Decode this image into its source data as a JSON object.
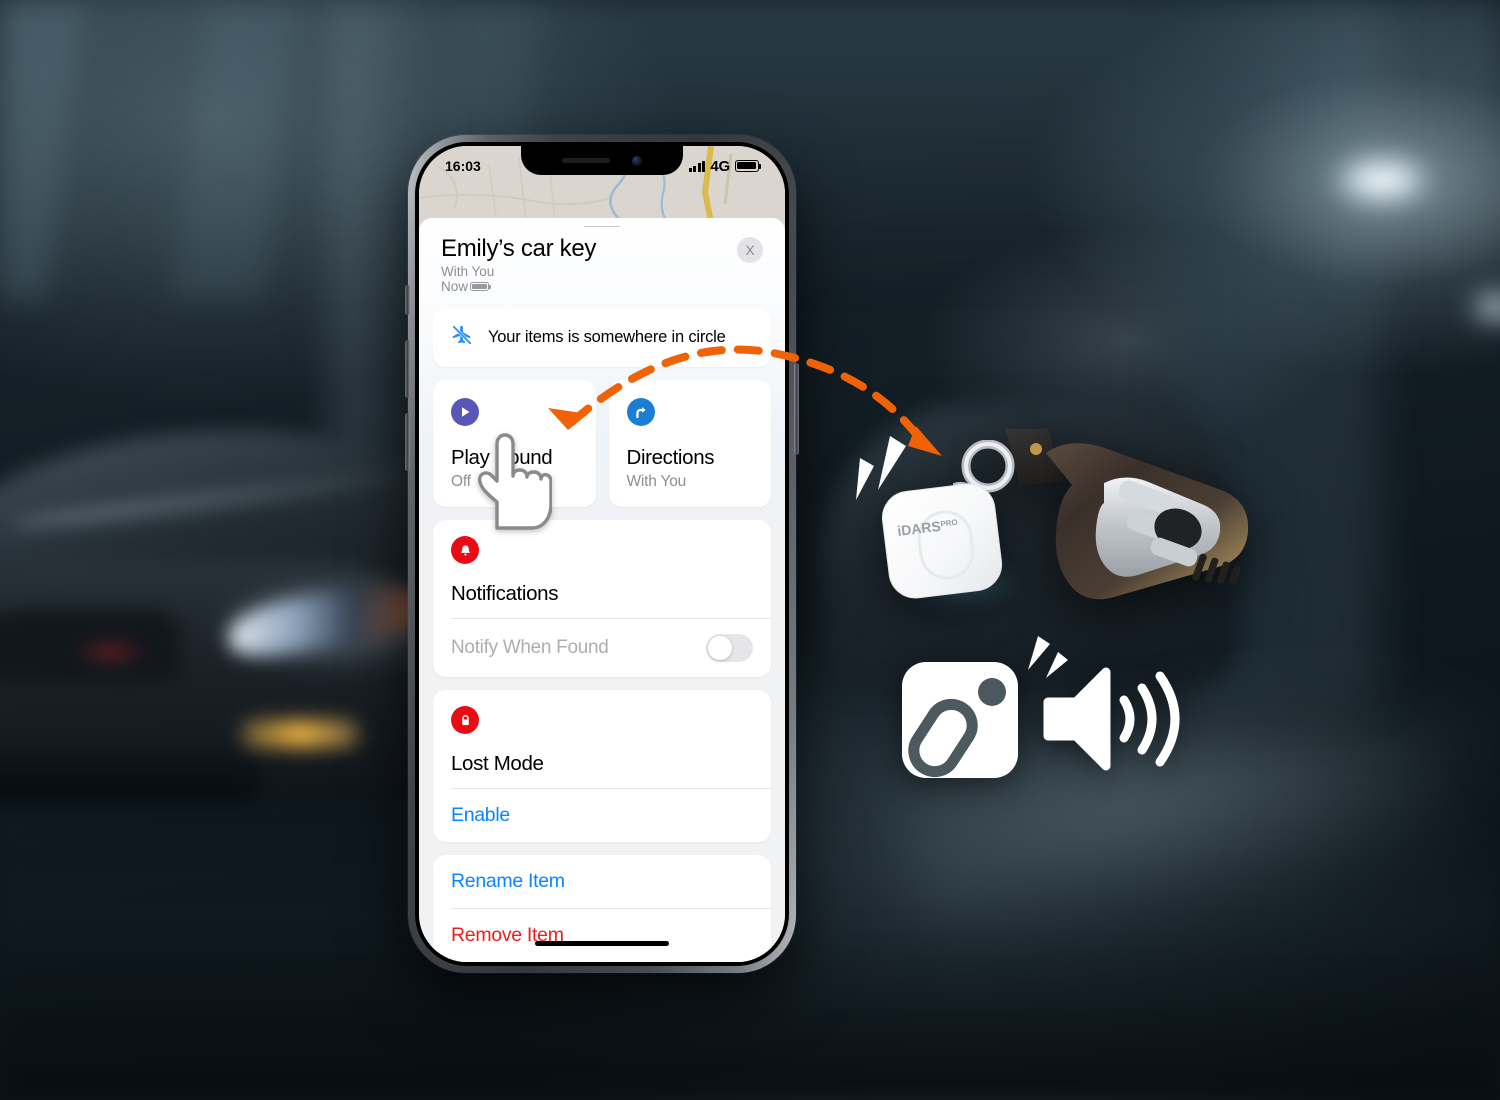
{
  "status_bar": {
    "time": "16:03",
    "network": "4G",
    "signal_icon": "cellular-bars-icon",
    "battery_icon": "battery-full-icon"
  },
  "sheet": {
    "grabber_name": "sheet-grabber",
    "title": "Emily’s car key",
    "subtitle_line1": "With You",
    "subtitle_line2": "Now",
    "battery_icon": "battery-small-icon",
    "close_label": "X"
  },
  "banner": {
    "icon": "airplane-off-icon",
    "text": "Your items is somewhere in circle"
  },
  "actions": [
    {
      "icon": "play-circle-icon",
      "title": "Play Sound",
      "subtitle": "Off",
      "accent": "#5856b8"
    },
    {
      "icon": "directions-arrow-icon",
      "title": "Directions",
      "subtitle": "With You",
      "accent": "#1a7fd4"
    }
  ],
  "notifications": {
    "icon": "bell-icon",
    "accent": "#ea0b15",
    "title": "Notifications",
    "row_label": "Notify When Found",
    "toggle_state": "off"
  },
  "lost_mode": {
    "icon": "lock-icon",
    "accent": "#ea0b15",
    "title": "Lost Mode",
    "enable_label": "Enable"
  },
  "item_actions": {
    "rename_label": "Rename Item",
    "remove_label": "Remove Item",
    "rename_color": "#0a84ff",
    "remove_color": "#e8201e"
  },
  "product": {
    "tracker_brand": "iDARS",
    "tracker_brand_suffix": "PRO",
    "tracker_name": "bluetooth-tracker-tag",
    "keyfob_name": "car-key-fob"
  },
  "badge": {
    "tracker_icon": "tracker-tile-icon",
    "speaker_icon": "speaker-waves-icon"
  },
  "annotation": {
    "arrow_name": "play-sound-to-tracker-arrow",
    "arrow_color": "#ef6206",
    "cursor_name": "hand-pointer-cursor"
  },
  "colors": {
    "link_blue": "#0a84ff",
    "danger_red": "#e8201e",
    "orange": "#ef6206",
    "purple": "#5856b8",
    "map_bg": "#e9e5dc"
  }
}
